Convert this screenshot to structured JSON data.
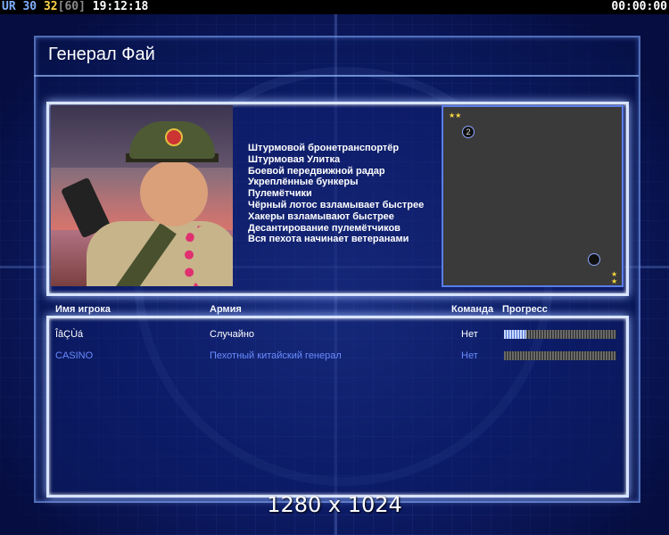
{
  "hud": {
    "ur_label": "UR",
    "fps": "30",
    "current": "32",
    "max": "[60]",
    "clock": "19:12:18",
    "timer": "00:00:00"
  },
  "title": "Генерал Фай",
  "general": {
    "features": [
      "Штурмовой бронетранспортёр",
      "Штурмовая Улитка",
      "Боевой передвижной радар",
      "Укреплённые бункеры",
      "Пулемётчики",
      "Чёрный лотос взламывает быстрее",
      "Хакеры взламывают быстрее",
      "Десантирование пулемётчиков",
      "Вся пехота начинает ветеранами"
    ]
  },
  "minimap": {
    "stars_top": "★★",
    "stars_bottom": "★\n★",
    "spot1_label": "2",
    "spot2_label": ""
  },
  "table": {
    "headers": {
      "name": "Имя игрока",
      "army": "Армия",
      "team": "Команда",
      "progress": "Прогресс"
    },
    "rows": [
      {
        "name": "ÎâÇÙá",
        "army": "Случайно",
        "team": "Нет",
        "progress": 0.2,
        "color": "#ffffff"
      },
      {
        "name": "CASINO",
        "army": "Пехотный китайский генерал",
        "team": "Нет",
        "progress": 0.0,
        "color": "#6a8cff"
      }
    ]
  },
  "resolution": "1280 x 1024"
}
